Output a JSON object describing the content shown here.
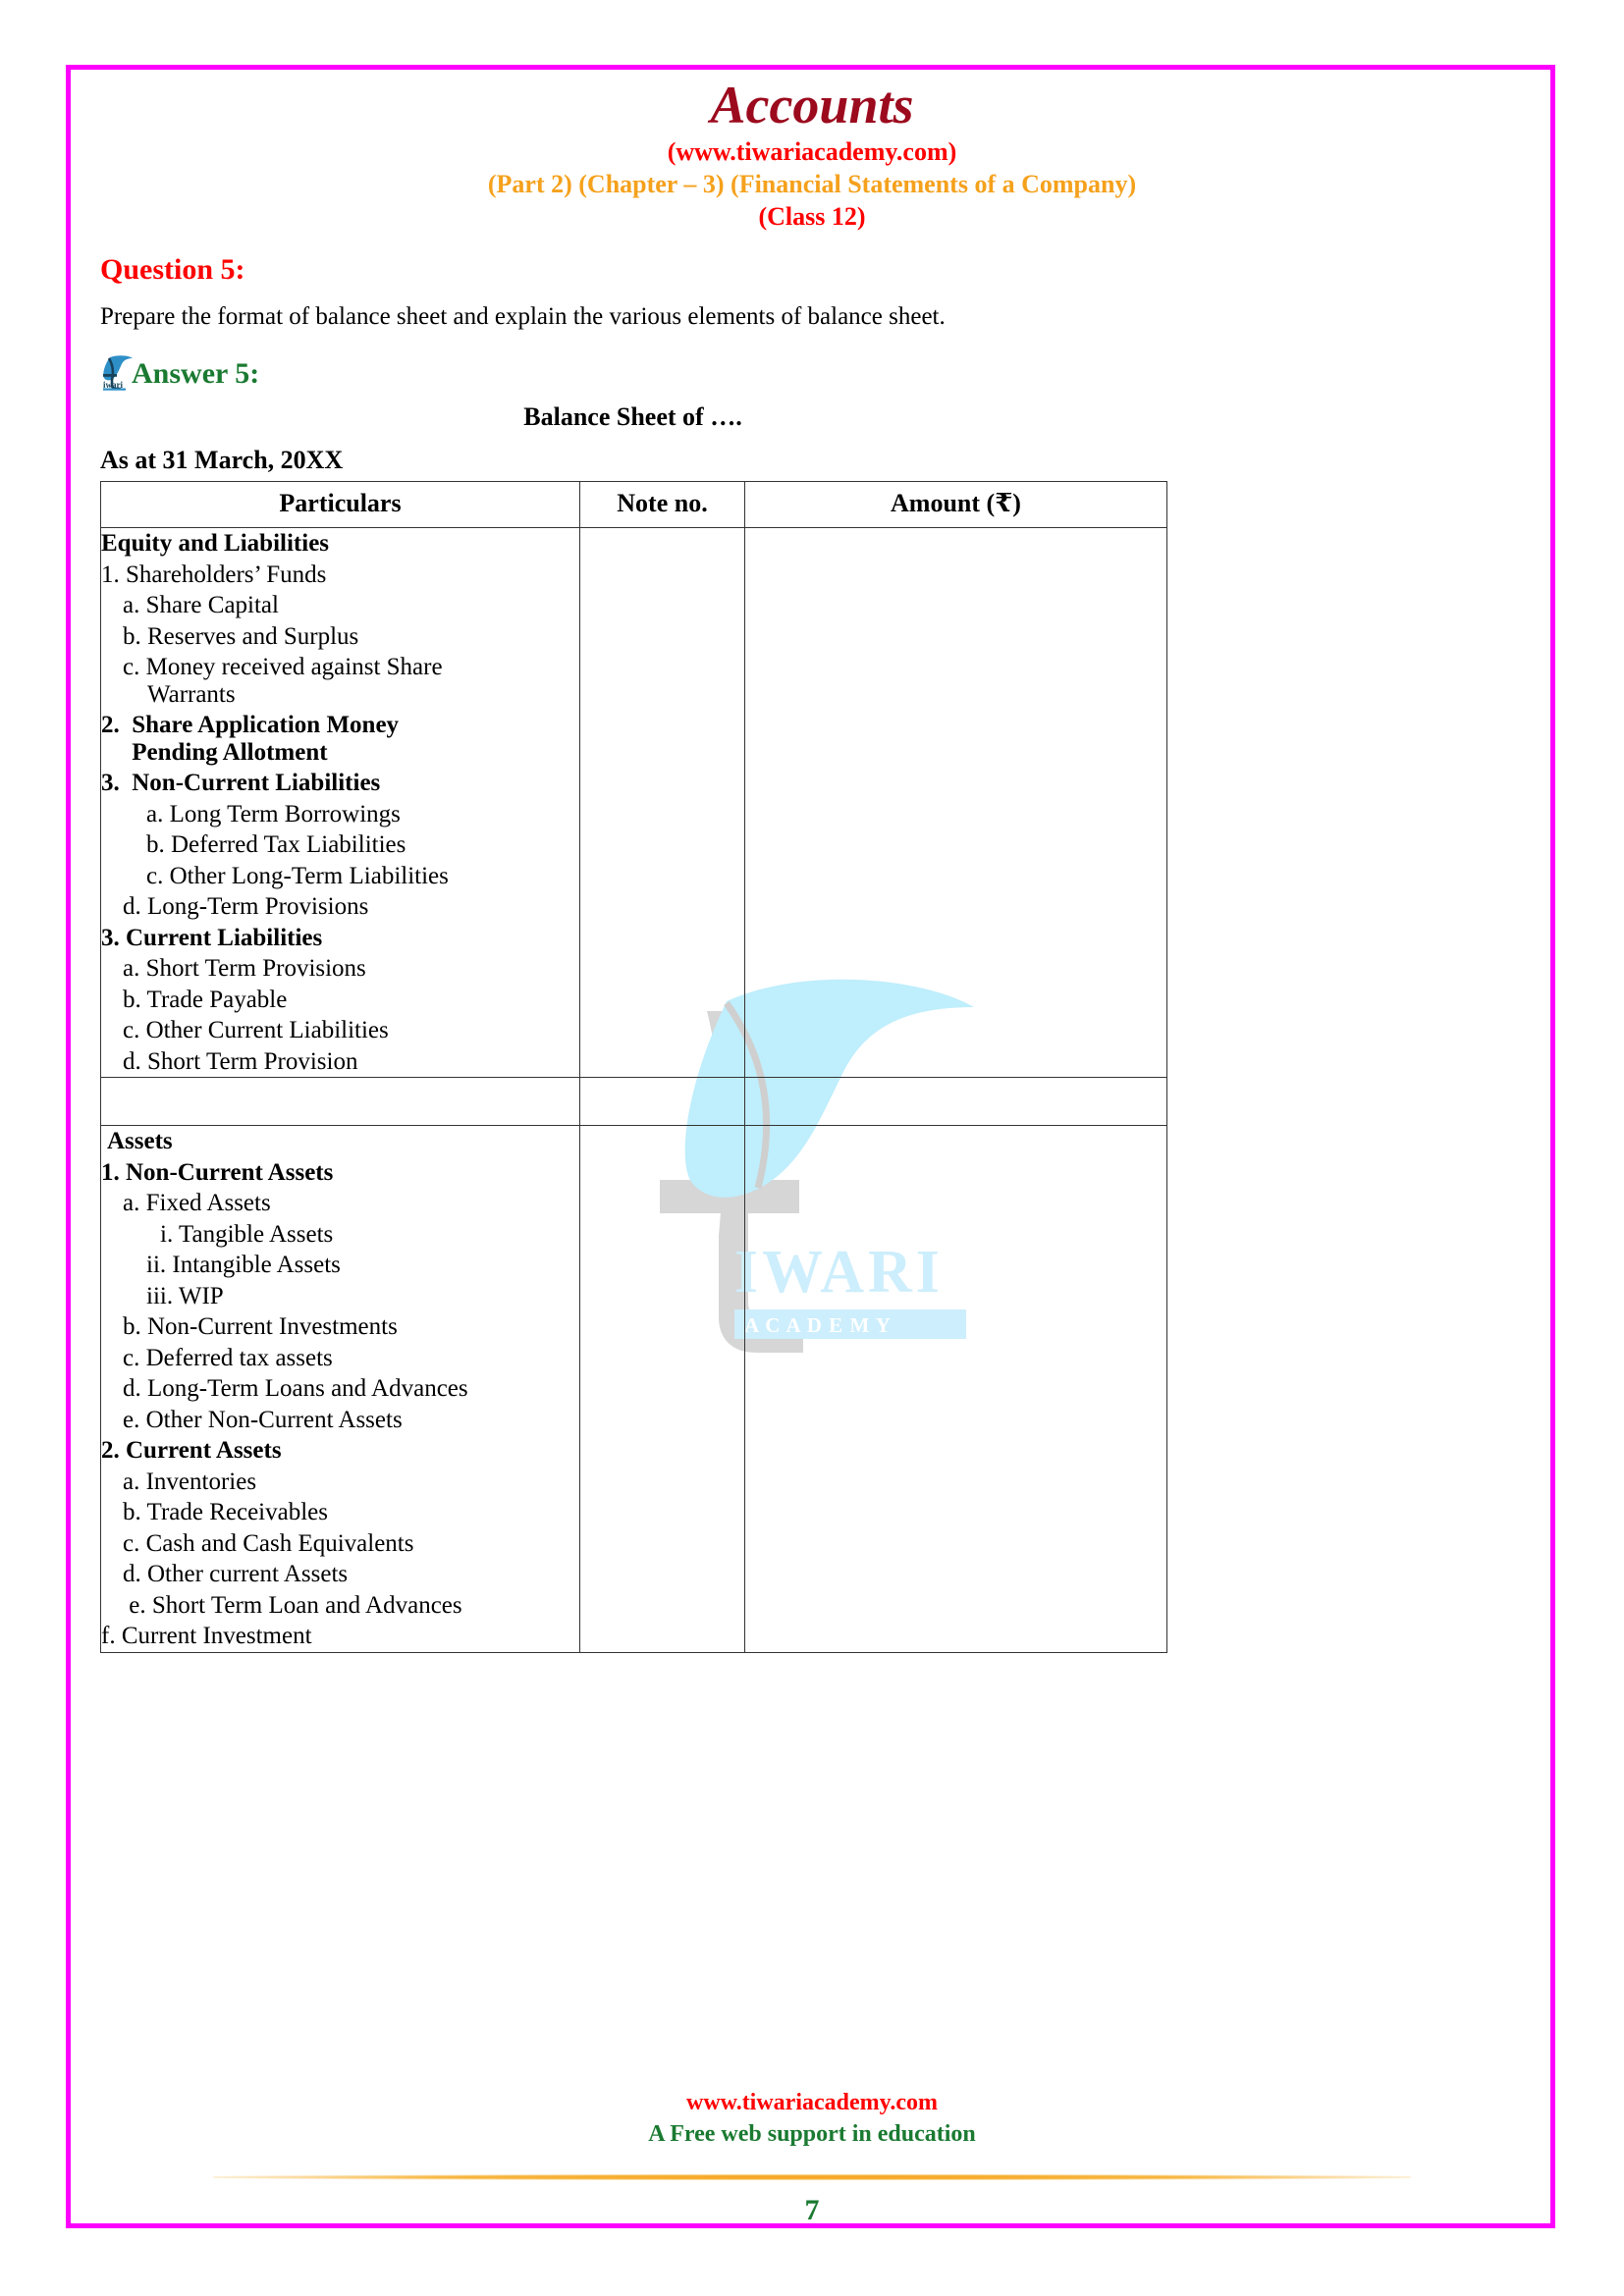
{
  "header": {
    "title": "Accounts",
    "site": "(www.tiwariacademy.com)",
    "chapter": "(Part 2) (Chapter – 3) (Financial Statements of a Company)",
    "class": "(Class 12)",
    "colors": {
      "title": "#9c0a1e",
      "site": "#ff0000",
      "chapter": "#f5a11c",
      "class": "#ff0000",
      "page_border": "#ff00ff"
    }
  },
  "question": {
    "heading": "Question 5:",
    "text": "Prepare the format of balance sheet and explain the various elements of balance sheet."
  },
  "answer": {
    "heading": "Answer 5:",
    "logo_icon": "tiwari-academy-feather-icon"
  },
  "balance_sheet": {
    "title": "Balance Sheet of ….",
    "as_at": "As at 31 March, 20XX",
    "columns": [
      "Particulars",
      "Note no.",
      "Amount (₹)"
    ],
    "sections": [
      {
        "name": "equity-and-liabilities",
        "lines": [
          {
            "text": "Equity and Liabilities",
            "bold": true,
            "indent": 0
          },
          {
            "text": "1. Shareholders’ Funds",
            "bold": false,
            "indent": 0
          },
          {
            "text": "a. Share Capital",
            "bold": false,
            "indent": 1
          },
          {
            "text": "b. Reserves and Surplus",
            "bold": false,
            "indent": 1
          },
          {
            "text": "c. Money received against Share\n    Warrants",
            "bold": false,
            "indent": 1
          },
          {
            "text": "2.  Share Application Money\n     Pending Allotment",
            "bold": true,
            "indent": 0
          },
          {
            "text": "3.  Non-Current Liabilities",
            "bold": true,
            "indent": 0
          },
          {
            "text": "a. Long Term Borrowings",
            "bold": false,
            "indent": 2
          },
          {
            "text": "b. Deferred Tax Liabilities",
            "bold": false,
            "indent": 2
          },
          {
            "text": "c. Other Long-Term Liabilities",
            "bold": false,
            "indent": 2
          },
          {
            "text": "d. Long-Term Provisions",
            "bold": false,
            "indent": 1
          },
          {
            "text": "3. Current Liabilities",
            "bold": true,
            "indent": 0
          },
          {
            "text": "a. Short Term Provisions",
            "bold": false,
            "indent": 1
          },
          {
            "text": "b. Trade Payable",
            "bold": false,
            "indent": 1
          },
          {
            "text": "c. Other Current Liabilities",
            "bold": false,
            "indent": 1
          },
          {
            "text": "d. Short Term Provision",
            "bold": false,
            "indent": 1
          }
        ]
      },
      {
        "name": "spacer-row",
        "lines": []
      },
      {
        "name": "assets",
        "lines": [
          {
            "text": "Assets",
            "bold": true,
            "indent": 0,
            "head": true
          },
          {
            "text": "1. Non-Current Assets",
            "bold": true,
            "indent": 0
          },
          {
            "text": "a. Fixed Assets",
            "bold": false,
            "indent": 1
          },
          {
            "text": "i. Tangible Assets",
            "bold": false,
            "indent": 3
          },
          {
            "text": "ii. Intangible Assets",
            "bold": false,
            "indent": 2
          },
          {
            "text": "iii. WIP",
            "bold": false,
            "indent": 2
          },
          {
            "text": "b. Non-Current Investments",
            "bold": false,
            "indent": 1
          },
          {
            "text": "c. Deferred tax assets",
            "bold": false,
            "indent": 1
          },
          {
            "text": "d. Long-Term Loans and Advances",
            "bold": false,
            "indent": 1
          },
          {
            "text": "e. Other Non-Current Assets",
            "bold": false,
            "indent": 1
          },
          {
            "text": "2. Current Assets",
            "bold": true,
            "indent": 0
          },
          {
            "text": "a. Inventories",
            "bold": false,
            "indent": 1
          },
          {
            "text": "b. Trade Receivables",
            "bold": false,
            "indent": 1
          },
          {
            "text": "c. Cash and Cash Equivalents",
            "bold": false,
            "indent": 1
          },
          {
            "text": "d. Other current Assets",
            "bold": false,
            "indent": 1
          },
          {
            "text": " e. Short Term Loan and Advances",
            "bold": false,
            "indent": 1
          },
          {
            "text": "f. Current Investment",
            "bold": false,
            "indent": 0
          }
        ]
      }
    ]
  },
  "watermark": {
    "brand_line1": "IWARI",
    "brand_line2": "A C A D E M Y",
    "icon": "tiwari-academy-feather-watermark"
  },
  "footer": {
    "site": "www.tiwariacademy.com",
    "tagline": "A Free web support in education",
    "page_number": "7"
  }
}
